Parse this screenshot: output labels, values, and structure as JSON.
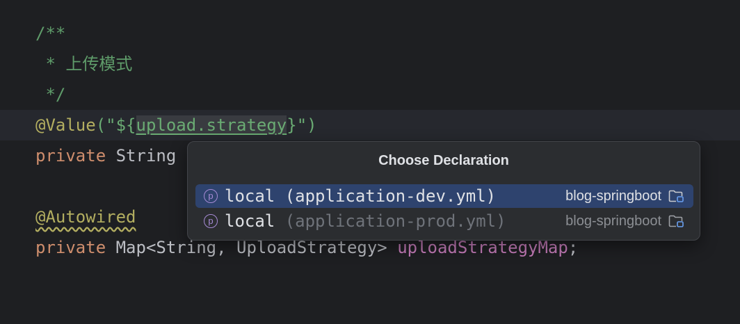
{
  "editor": {
    "comment_open": "/**",
    "comment_star": " * ",
    "comment_text": "上传模式",
    "comment_close": " */",
    "annotation_value": "@Value",
    "value_prefix": "(\"${",
    "value_key": "upload.strategy",
    "value_suffix": "}\")",
    "line5_kw": "private",
    "line5_type": " String",
    "annotation_autowired": "@Autowired",
    "line8_kw": "private",
    "line8_type": " Map<String, UploadStrategy> ",
    "line8_field": "uploadStrategyMap",
    "line8_semi": ";"
  },
  "popup": {
    "title": "Choose Declaration",
    "items": [
      {
        "icon_letter": "p",
        "name": "local",
        "file": " (application-dev.yml)",
        "module": "blog-springboot",
        "icon": "property-icon",
        "module_icon": "module-folder-icon",
        "selected": true
      },
      {
        "icon_letter": "p",
        "name": "local",
        "file": " (application-prod.yml)",
        "module": "blog-springboot",
        "icon": "property-icon",
        "module_icon": "module-folder-icon",
        "selected": false
      }
    ]
  },
  "colors": {
    "background": "#1e1f22",
    "comment": "#5f9c6a",
    "keyword": "#cf8e6d",
    "annotation": "#b3ae60",
    "string": "#6aab73",
    "field": "#c77dbb",
    "selection": "#2e436e"
  }
}
